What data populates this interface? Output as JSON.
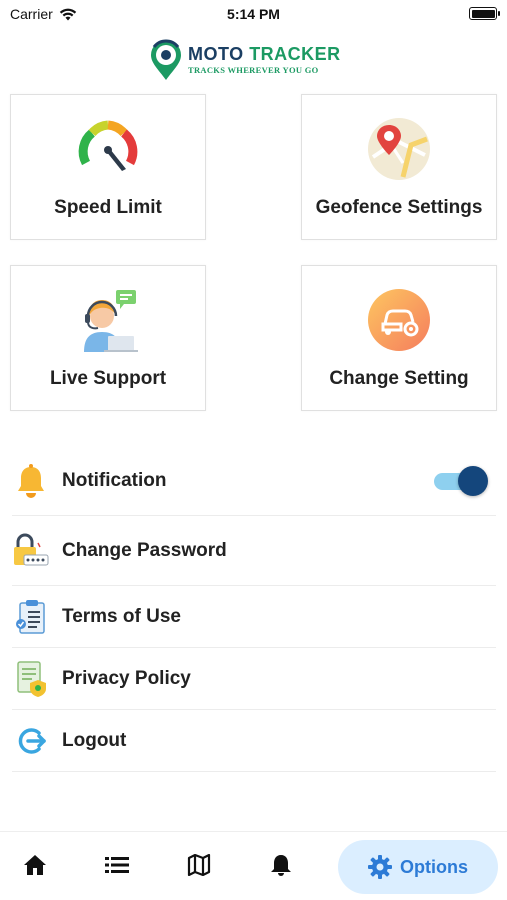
{
  "status_bar": {
    "carrier": "Carrier",
    "time": "5:14 PM"
  },
  "logo": {
    "title_part1": "MOTO",
    "title_part2": "TRACKER",
    "tagline": "TRACKS WHEREVER YOU GO"
  },
  "cards": [
    {
      "label": "Speed Limit",
      "icon": "speedometer-icon"
    },
    {
      "label": "Geofence Settings",
      "icon": "map-pin-icon"
    },
    {
      "label": "Live Support",
      "icon": "support-agent-icon"
    },
    {
      "label": "Change Setting",
      "icon": "car-settings-icon"
    }
  ],
  "menu": {
    "notification": {
      "label": "Notification",
      "toggle_on": true
    },
    "change_password": {
      "label": "Change Password"
    },
    "terms": {
      "label": "Terms of Use"
    },
    "privacy": {
      "label": "Privacy Policy"
    },
    "logout": {
      "label": "Logout"
    }
  },
  "tab_bar": {
    "items": [
      "home-icon",
      "list-icon",
      "map-icon",
      "bell-icon"
    ],
    "active": {
      "label": "Options",
      "icon": "gear-icon"
    }
  },
  "colors": {
    "brand_navy": "#1b3f63",
    "brand_green": "#1c9a63",
    "toggle_knob": "#14467c",
    "toggle_track": "#8ed0ef",
    "active_tab_bg": "#dbeeff",
    "active_tab_text": "#2d7bd6"
  }
}
